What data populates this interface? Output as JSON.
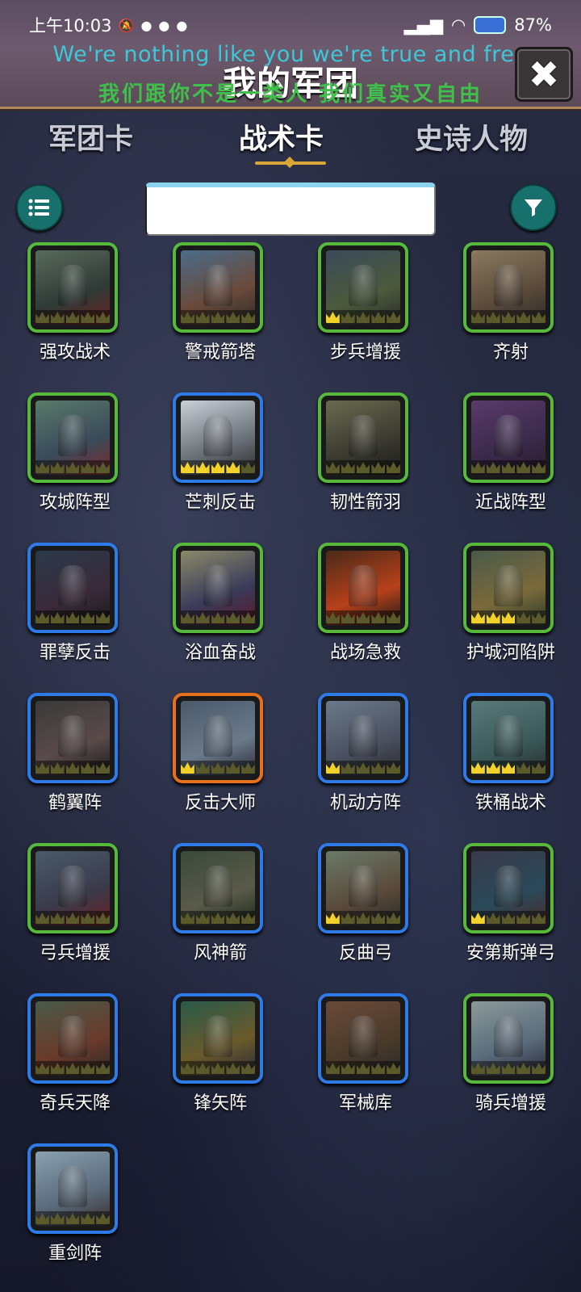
{
  "status_bar": {
    "time": "上午10:03",
    "battery": "87"
  },
  "header": {
    "lyric_en": "We're nothing like you we're true and free",
    "title": "我的军团",
    "lyric_zh": "我们跟你不是一类人 我们真实又自由",
    "close_glyph": "✖"
  },
  "tabs": [
    {
      "label": "军团卡",
      "active": false
    },
    {
      "label": "战术卡",
      "active": true
    },
    {
      "label": "史诗人物",
      "active": false
    }
  ],
  "toolbar": {
    "list_icon": "list-icon",
    "filter_icon": "filter-icon",
    "search_value": ""
  },
  "cards": [
    {
      "name": "强攻战术",
      "rarity": "green",
      "crowns": 0,
      "colors": [
        "#5a6a5c",
        "#2e3a36",
        "#6a2020"
      ]
    },
    {
      "name": "警戒箭塔",
      "rarity": "green",
      "crowns": 0,
      "colors": [
        "#4a6c8a",
        "#6a4a3a",
        "#2a2a2a"
      ]
    },
    {
      "name": "步兵增援",
      "rarity": "green",
      "crowns": 1,
      "colors": [
        "#3a4a5a",
        "#4c5a3c",
        "#2a2a2a"
      ]
    },
    {
      "name": "齐射",
      "rarity": "green",
      "crowns": 0,
      "colors": [
        "#8a7a60",
        "#5a4a3a",
        "#2a2a2a"
      ]
    },
    {
      "name": "攻城阵型",
      "rarity": "green",
      "crowns": 0,
      "colors": [
        "#5a7a6a",
        "#3a4a5a",
        "#7a2a2a"
      ]
    },
    {
      "name": "芒刺反击",
      "rarity": "blue",
      "crowns": 4,
      "colors": [
        "#c8d0d8",
        "#6a7078",
        "#2a2a2a"
      ]
    },
    {
      "name": "韧性箭羽",
      "rarity": "green",
      "crowns": 0,
      "colors": [
        "#6a6a50",
        "#3a3a30",
        "#1a1a1a"
      ]
    },
    {
      "name": "近战阵型",
      "rarity": "green",
      "crowns": 0,
      "colors": [
        "#5a3a6a",
        "#3a2a4a",
        "#2a1a2a"
      ]
    },
    {
      "name": "罪孽反击",
      "rarity": "blue",
      "crowns": 0,
      "colors": [
        "#2a3a4a",
        "#3a2a3a",
        "#1a1a1a"
      ]
    },
    {
      "name": "浴血奋战",
      "rarity": "green",
      "crowns": 0,
      "colors": [
        "#8a8a6a",
        "#3a3a5a",
        "#5a1a2a"
      ]
    },
    {
      "name": "战场急救",
      "rarity": "green",
      "crowns": 0,
      "colors": [
        "#4a2a1a",
        "#b8401a",
        "#1a1a1a"
      ]
    },
    {
      "name": "护城河陷阱",
      "rarity": "green",
      "crowns": 3,
      "colors": [
        "#4a5a4a",
        "#7a6a3a",
        "#2a3a2a"
      ]
    },
    {
      "name": "鹤翼阵",
      "rarity": "blue",
      "crowns": 0,
      "colors": [
        "#3a3a3a",
        "#5a4a4a",
        "#1a1a1a"
      ]
    },
    {
      "name": "反击大师",
      "rarity": "orange",
      "crowns": 1,
      "colors": [
        "#4a5a6a",
        "#6a7a8a",
        "#2a2a3a"
      ]
    },
    {
      "name": "机动方阵",
      "rarity": "blue",
      "crowns": 1,
      "colors": [
        "#6a7a8a",
        "#4a5060",
        "#2a2a2a"
      ]
    },
    {
      "name": "铁桶战术",
      "rarity": "blue",
      "crowns": 3,
      "colors": [
        "#5a7a7a",
        "#3a5a5a",
        "#2a2a2a"
      ]
    },
    {
      "name": "弓兵增援",
      "rarity": "green",
      "crowns": 0,
      "colors": [
        "#4a5a6a",
        "#3a3a4a",
        "#6a2020"
      ]
    },
    {
      "name": "风神箭",
      "rarity": "blue",
      "crowns": 0,
      "colors": [
        "#3a4a3a",
        "#5a5a4a",
        "#1a2a1a"
      ]
    },
    {
      "name": "反曲弓",
      "rarity": "blue",
      "crowns": 1,
      "colors": [
        "#6a7a6a",
        "#5a4a3a",
        "#2a2a2a"
      ]
    },
    {
      "name": "安第斯弹弓",
      "rarity": "green",
      "crowns": 1,
      "colors": [
        "#3a3a4a",
        "#2a4a5a",
        "#4a2a2a"
      ]
    },
    {
      "name": "奇兵天降",
      "rarity": "blue",
      "crowns": 0,
      "colors": [
        "#4a5a4a",
        "#6a3a2a",
        "#2a2a2a"
      ]
    },
    {
      "name": "锋矢阵",
      "rarity": "blue",
      "crowns": 0,
      "colors": [
        "#2a5a4a",
        "#6a5a2a",
        "#2a2a3a"
      ]
    },
    {
      "name": "军械库",
      "rarity": "blue",
      "crowns": 0,
      "colors": [
        "#6a4a3a",
        "#4a3a2a",
        "#2a2a2a"
      ]
    },
    {
      "name": "骑兵增援",
      "rarity": "green",
      "crowns": 0,
      "colors": [
        "#8a9a9a",
        "#5a6a7a",
        "#2a2a3a"
      ]
    },
    {
      "name": "重剑阵",
      "rarity": "blue",
      "crowns": 0,
      "colors": [
        "#8aa0b0",
        "#5a6a7a",
        "#3a2a2a"
      ]
    }
  ]
}
